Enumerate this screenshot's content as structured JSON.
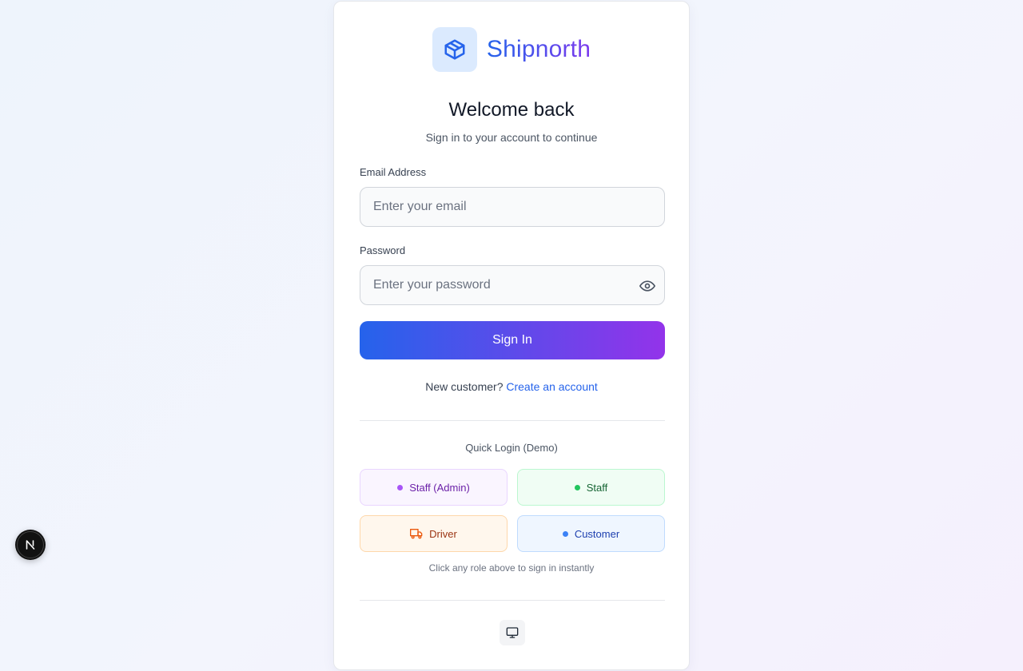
{
  "brand": {
    "name": "Shipnorth",
    "logo_icon": "package-icon"
  },
  "header": {
    "title": "Welcome back",
    "subtitle": "Sign in to your account to continue"
  },
  "form": {
    "email_label": "Email Address",
    "email_placeholder": "Enter your email",
    "email_value": "",
    "password_label": "Password",
    "password_placeholder": "Enter your password",
    "password_value": "",
    "password_toggle_icon": "eye-icon",
    "submit_label": "Sign In"
  },
  "signup": {
    "prompt": "New customer?",
    "link_label": "Create an account"
  },
  "quick_login": {
    "title": "Quick Login (Demo)",
    "roles": [
      {
        "label": "Staff (Admin)",
        "icon": "purple-dot",
        "color": "#a855f7"
      },
      {
        "label": "Staff",
        "icon": "green-dot",
        "color": "#22c55e"
      },
      {
        "label": "Driver",
        "icon": "truck-icon",
        "color": "#ea580c"
      },
      {
        "label": "Customer",
        "icon": "blue-dot",
        "color": "#3b82f6"
      }
    ],
    "hint": "Click any role above to sign in instantly"
  },
  "footer": {
    "theme_icon": "monitor-icon"
  },
  "dev_badge": {
    "letter": "N",
    "icon": "nextjs-icon"
  },
  "colors": {
    "accent_start": "#2563eb",
    "accent_end": "#9333ea",
    "link": "#2563eb"
  }
}
